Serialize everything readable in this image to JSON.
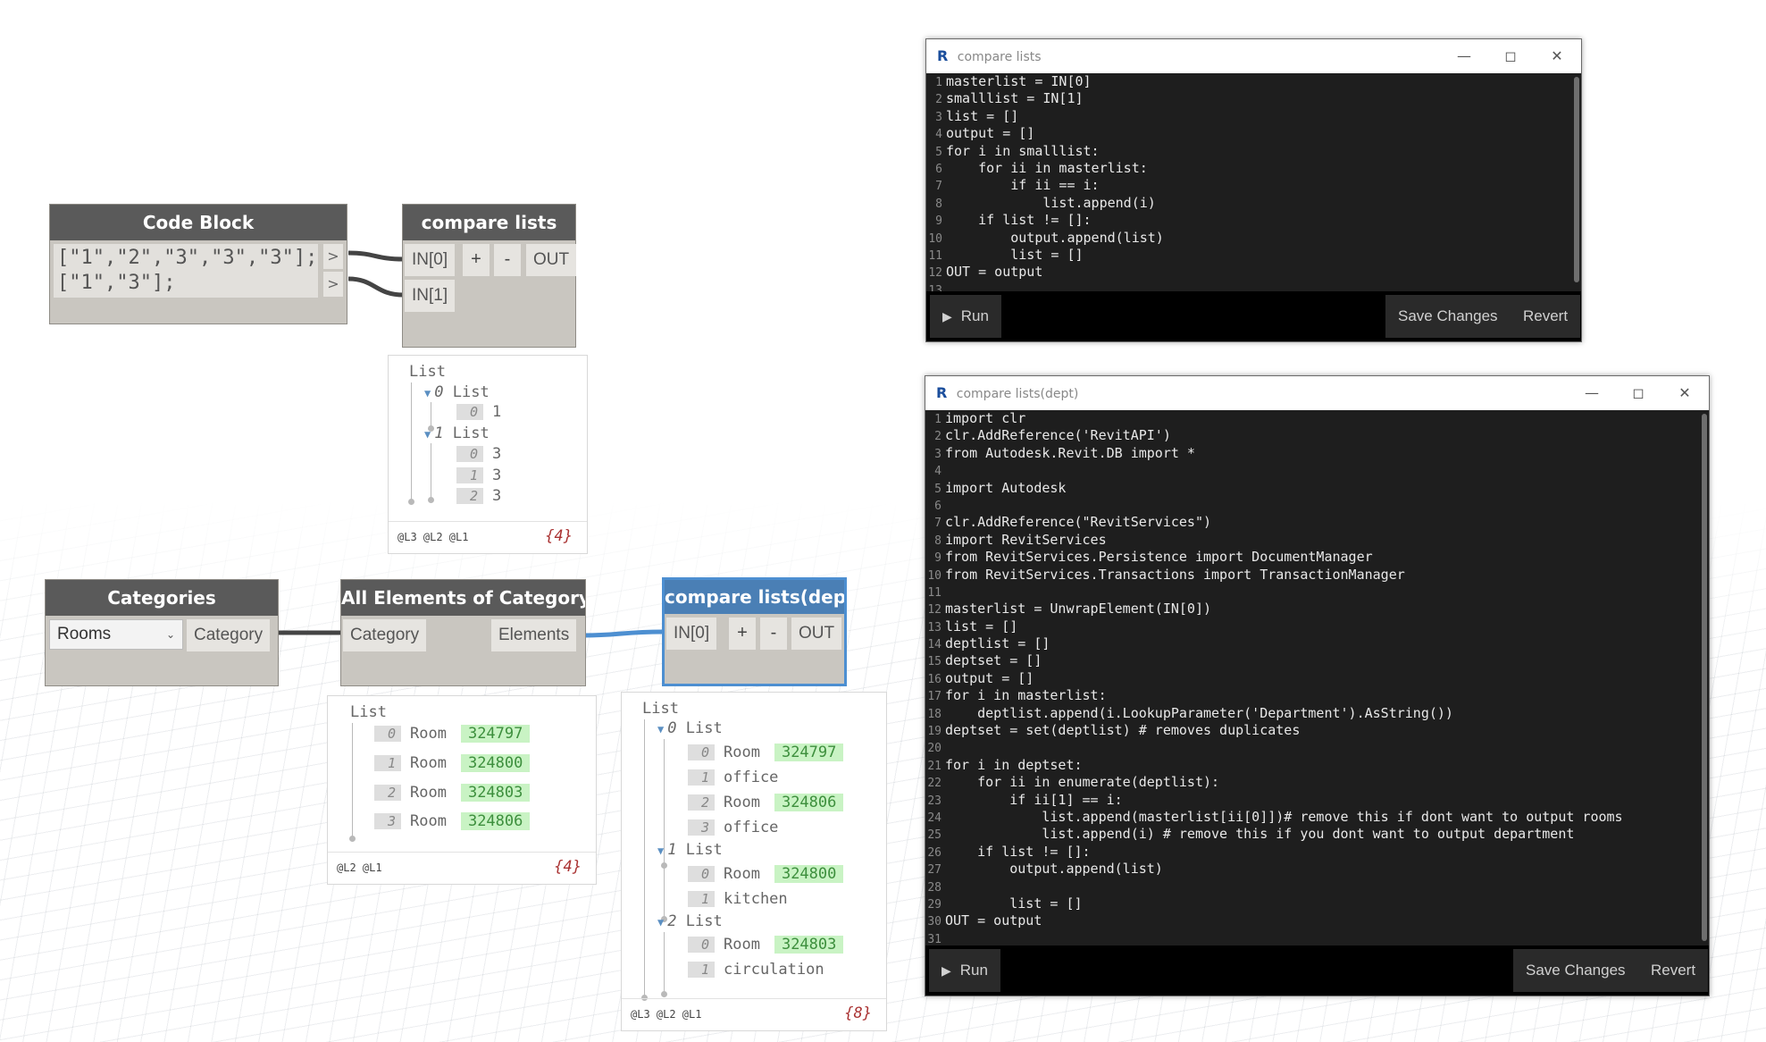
{
  "nodes": {
    "code_block": {
      "title": "Code Block",
      "lines": [
        "[\"1\",\"2\",\"3\",\"3\",\"3\"];",
        "[\"1\",\"3\"];"
      ],
      "out_ports": [
        ">",
        ">"
      ]
    },
    "compare_lists": {
      "title": "compare lists",
      "inputs": [
        "IN[0]",
        "IN[1]"
      ],
      "add": "+",
      "remove": "-",
      "output": "OUT"
    },
    "categories": {
      "title": "Categories",
      "selected": "Rooms",
      "dropdown_icon": "chevron-down-icon",
      "output": "Category"
    },
    "all_elements": {
      "title": "All Elements of Category",
      "input": "Category",
      "output": "Elements"
    },
    "compare_lists_dept": {
      "title": "compare lists(dept)",
      "inputs": [
        "IN[0]"
      ],
      "add": "+",
      "remove": "-",
      "output": "OUT"
    }
  },
  "previews": {
    "compare_lists": {
      "root": "List",
      "groups": [
        {
          "index": "0",
          "label": "List",
          "items": [
            {
              "index": "0",
              "value": "1"
            }
          ]
        },
        {
          "index": "1",
          "label": "List",
          "items": [
            {
              "index": "0",
              "value": "3"
            },
            {
              "index": "1",
              "value": "3"
            },
            {
              "index": "2",
              "value": "3"
            }
          ]
        }
      ],
      "levels": "@L3 @L2 @L1",
      "count": "{4}"
    },
    "all_elements": {
      "root": "List",
      "items": [
        {
          "index": "0",
          "type": "Room",
          "value": "324797"
        },
        {
          "index": "1",
          "type": "Room",
          "value": "324800"
        },
        {
          "index": "2",
          "type": "Room",
          "value": "324803"
        },
        {
          "index": "3",
          "type": "Room",
          "value": "324806"
        }
      ],
      "levels": "@L2 @L1",
      "count": "{4}"
    },
    "compare_lists_dept": {
      "root": "List",
      "groups": [
        {
          "index": "0",
          "label": "List",
          "items": [
            {
              "index": "0",
              "type": "Room",
              "value": "324797"
            },
            {
              "index": "1",
              "type": "office",
              "value": ""
            },
            {
              "index": "2",
              "type": "Room",
              "value": "324806"
            },
            {
              "index": "3",
              "type": "office",
              "value": ""
            }
          ]
        },
        {
          "index": "1",
          "label": "List",
          "items": [
            {
              "index": "0",
              "type": "Room",
              "value": "324800"
            },
            {
              "index": "1",
              "type": "kitchen",
              "value": ""
            }
          ]
        },
        {
          "index": "2",
          "label": "List",
          "items": [
            {
              "index": "0",
              "type": "Room",
              "value": "324803"
            },
            {
              "index": "1",
              "type": "circulation",
              "value": ""
            }
          ]
        }
      ],
      "levels": "@L3 @L2 @L1",
      "count": "{8}"
    }
  },
  "editors": {
    "compare_lists": {
      "title": "compare lists",
      "logo": "R",
      "controls": [
        "minimize-icon",
        "maximize-icon",
        "close-icon"
      ],
      "run_label": "Run",
      "save_label": "Save Changes",
      "revert_label": "Revert",
      "code": [
        "masterlist = IN[0]",
        "smalllist = IN[1]",
        "list = []",
        "output = []",
        "for i in smalllist:",
        "    for ii in masterlist:",
        "        if ii == i:",
        "            list.append(i)",
        "    if list != []:",
        "        output.append(list)",
        "        list = []",
        "OUT = output",
        ""
      ]
    },
    "compare_lists_dept": {
      "title": "compare lists(dept)",
      "logo": "R",
      "controls": [
        "minimize-icon",
        "maximize-icon",
        "close-icon"
      ],
      "run_label": "Run",
      "save_label": "Save Changes",
      "revert_label": "Revert",
      "code": [
        "import clr",
        "clr.AddReference('RevitAPI')",
        "from Autodesk.Revit.DB import *",
        "",
        "import Autodesk",
        "",
        "clr.AddReference(\"RevitServices\")",
        "import RevitServices",
        "from RevitServices.Persistence import DocumentManager",
        "from RevitServices.Transactions import TransactionManager",
        "",
        "masterlist = UnwrapElement(IN[0])",
        "list = []",
        "deptlist = []",
        "deptset = []",
        "output = []",
        "for i in masterlist:",
        "    deptlist.append(i.LookupParameter('Department').AsString())",
        "deptset = set(deptlist) # removes duplicates",
        "",
        "for i in deptset:",
        "    for ii in enumerate(deptlist):",
        "        if ii[1] == i:",
        "            list.append(masterlist[ii[0]])# remove this if dont want to output rooms",
        "            list.append(i) # remove this if you dont want to output department",
        "    if list != []:",
        "        output.append(list)",
        "",
        "        list = []",
        "OUT = output",
        ""
      ]
    }
  }
}
